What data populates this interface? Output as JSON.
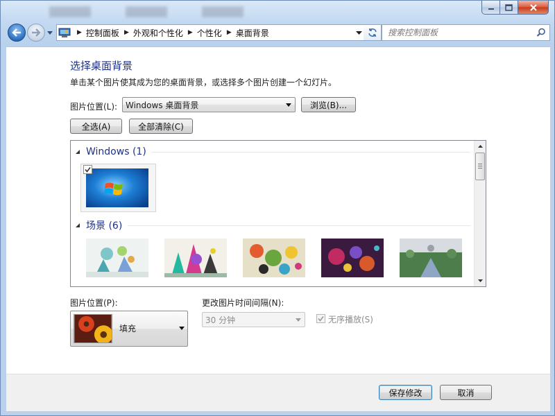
{
  "window": {
    "caption_buttons": {
      "minimize": "minimize-icon",
      "maximize": "maximize-icon",
      "close": "close-icon"
    }
  },
  "nav": {
    "breadcrumbs": [
      "控制面板",
      "外观和个性化",
      "个性化",
      "桌面背景"
    ],
    "search_placeholder": "搜索控制面板"
  },
  "page": {
    "title": "选择桌面背景",
    "description": "单击某个图片使其成为您的桌面背景，或选择多个图片创建一个幻灯片。",
    "location_label": "图片位置(L):",
    "location_value": "Windows 桌面背景",
    "browse_button": "浏览(B)...",
    "select_all_button": "全选(A)",
    "clear_all_button": "全部清除(C)"
  },
  "gallery": {
    "groups": [
      {
        "name": "Windows",
        "count": "(1)"
      },
      {
        "name": "场景",
        "count": "(6)"
      }
    ]
  },
  "options": {
    "position_label": "图片位置(P):",
    "position_value": "填充",
    "interval_label": "更改图片时间间隔(N):",
    "interval_value": "30 分钟",
    "shuffle_label": "无序播放(S)",
    "shuffle_checked": true
  },
  "footer": {
    "save_button": "保存修改",
    "cancel_button": "取消"
  },
  "colors": {
    "title_blue": "#1e3287",
    "window_frame": "#c3d9f1"
  }
}
